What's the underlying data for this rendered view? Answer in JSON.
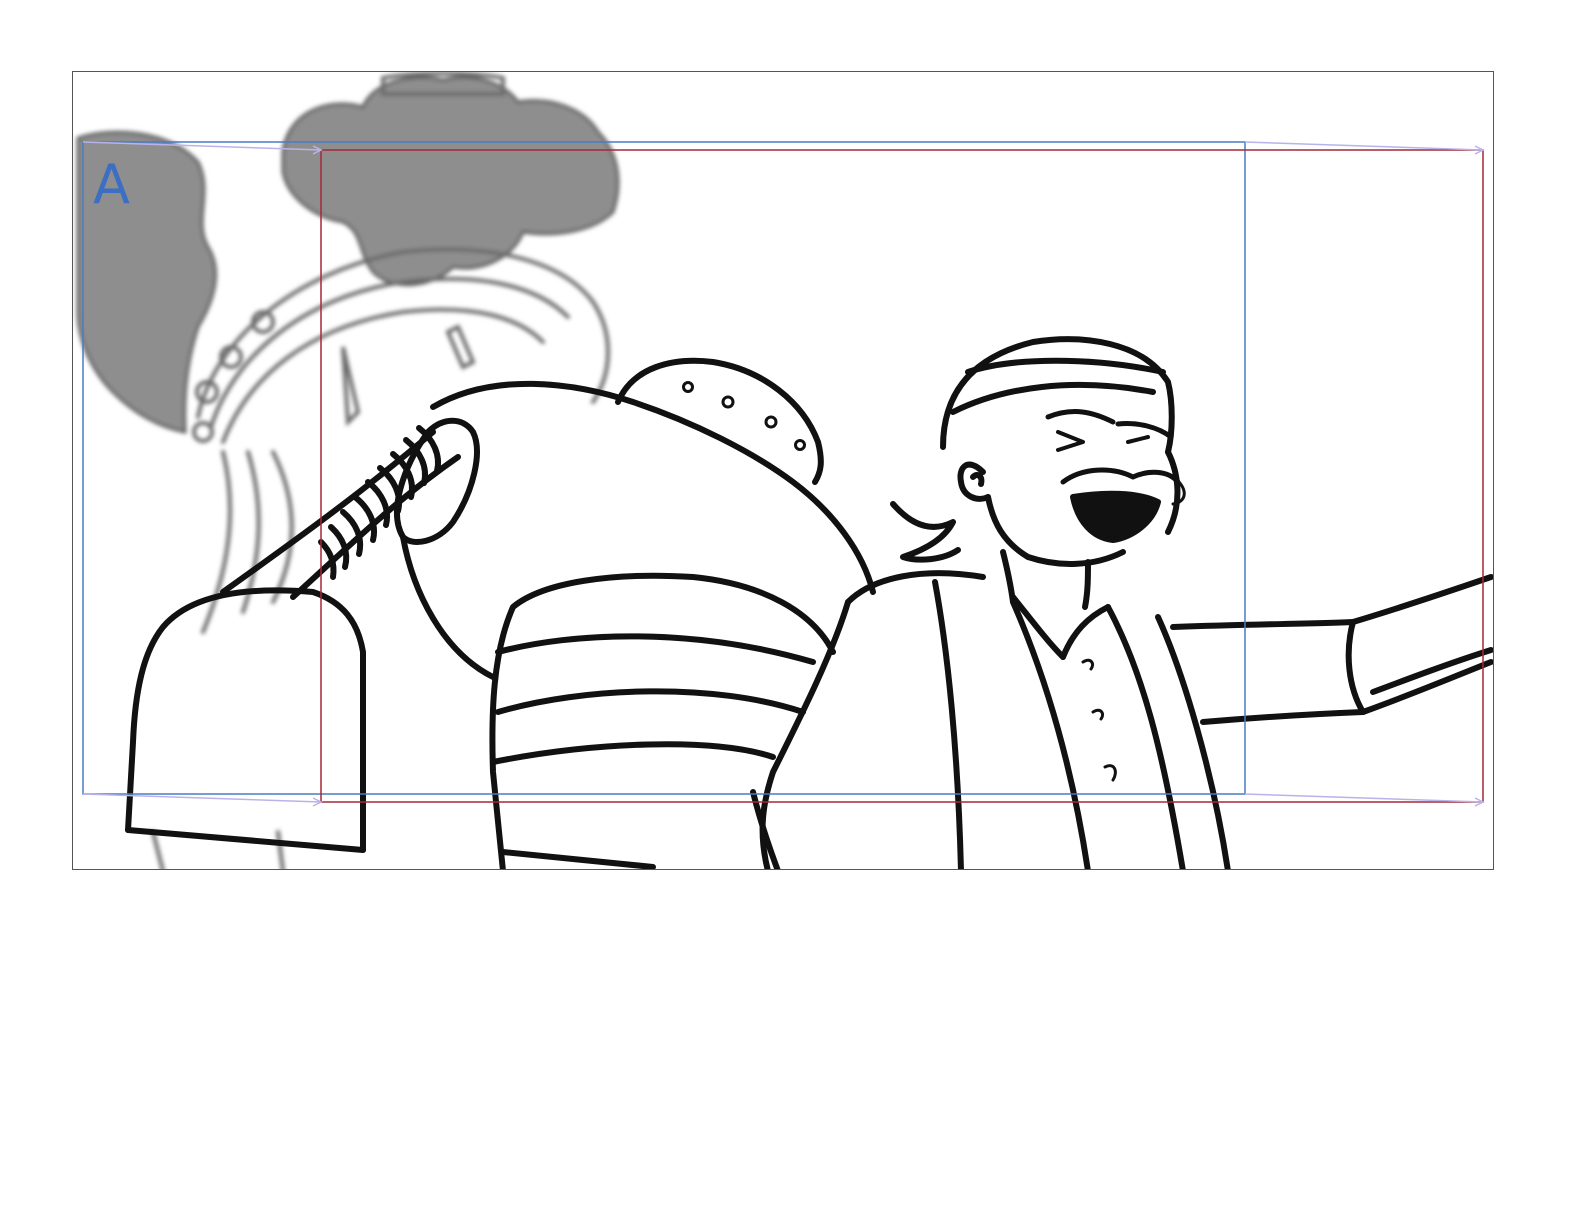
{
  "panel": {
    "camera_label": "A"
  },
  "colors": {
    "camera_a_frame": "#4a7cc4",
    "camera_b_frame": "#a42a38",
    "camera_path": "#b8b4ea",
    "label": "#3c6fc4",
    "line_art": "#111111",
    "smoke": "#8e8e8e",
    "background_sketch": "#6a6a6a"
  },
  "icons": {
    "character": "bearded-man-shouting-illustration",
    "machine": "steampunk-robot-illustration",
    "smoke": "smoke-cloud-illustration"
  }
}
